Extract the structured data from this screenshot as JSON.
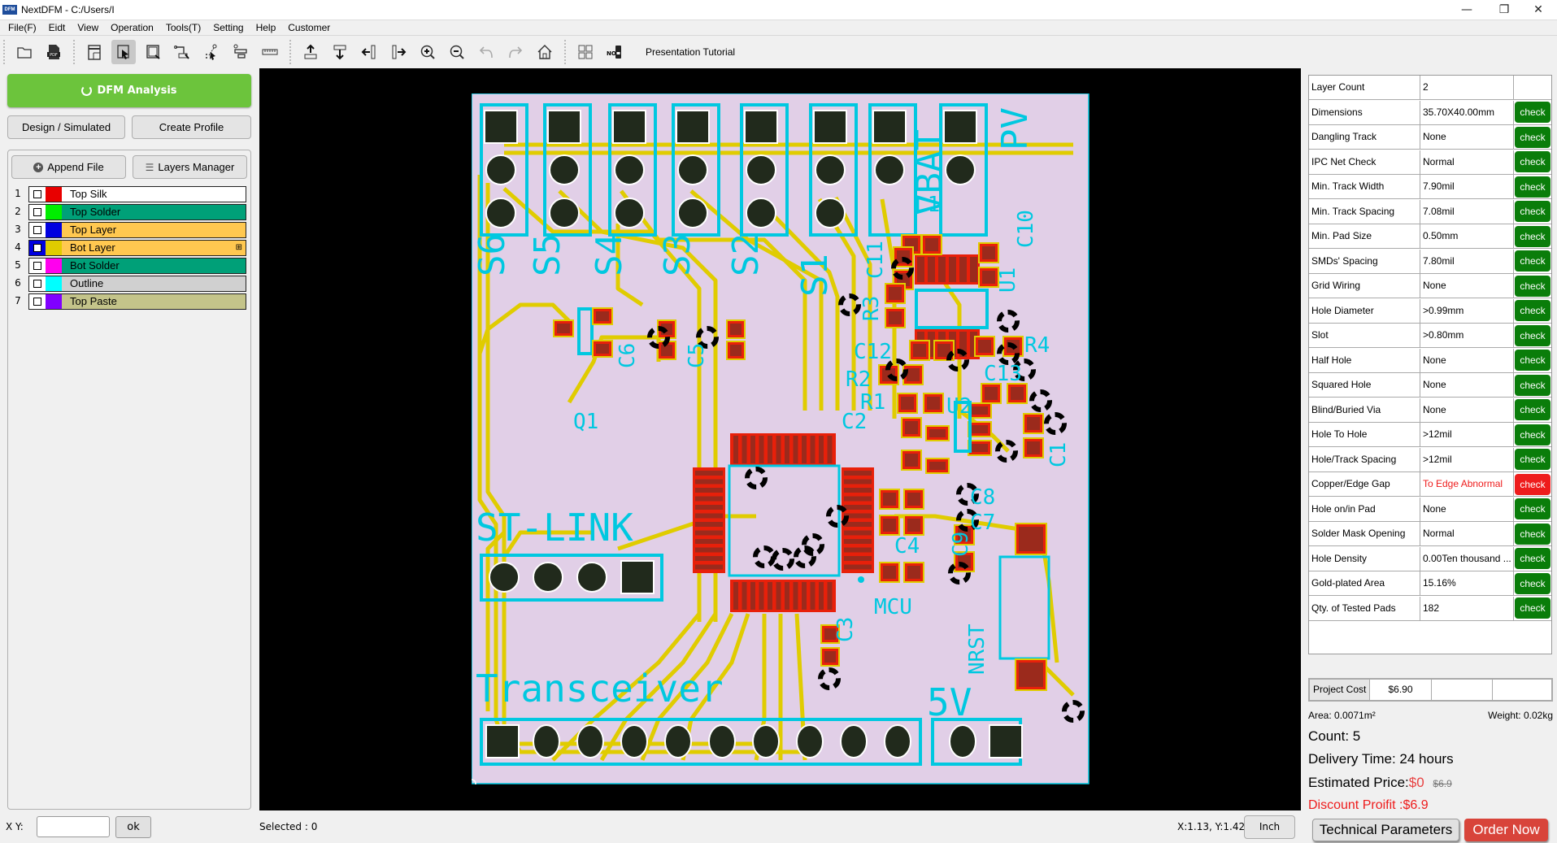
{
  "window": {
    "app_logo": "DFM",
    "title": "NextDFM - C:/Users/I",
    "controls": [
      "minimize",
      "restore",
      "close"
    ]
  },
  "menu": [
    "File(F)",
    "Eidt",
    "View",
    "Operation",
    "Tools(T)",
    "Setting",
    "Help",
    "Customer"
  ],
  "toolbar": {
    "groups": [
      [
        "open-folder-icon",
        "pdf-icon"
      ],
      [
        "single-view-icon",
        "select-icon",
        "window-select-icon",
        "move-select-icon",
        "node-select-icon",
        "align-icon",
        "ruler-icon"
      ],
      [
        "align-top-icon",
        "align-bottom-icon",
        "align-left-icon",
        "align-right-icon",
        "zoom-in-icon",
        "zoom-out-icon",
        "undo-icon",
        "redo-icon",
        "home-icon"
      ],
      [
        "panel-grid-icon",
        "number-icon"
      ]
    ],
    "active": "select-icon",
    "tutorial_label": "Presentation Tutorial"
  },
  "left_panel": {
    "dfm_button": "DFM Analysis",
    "design_button": "Design / Simulated",
    "create_profile_button": "Create Profile",
    "append_file_button": "Append File",
    "layers_manager_button": "Layers Manager",
    "layers": [
      {
        "num": "1",
        "name": "Top Silk",
        "swatch": "#e80000",
        "bg": "#ffffff",
        "checked": false
      },
      {
        "num": "2",
        "name": "Top Solder",
        "swatch": "#00ee00",
        "bg": "#00a078",
        "checked": false
      },
      {
        "num": "3",
        "name": "Top Layer",
        "swatch": "#0000e0",
        "bg": "#ffc850",
        "checked": false
      },
      {
        "num": "4",
        "name": "Bot Layer",
        "swatch": "#e0cc00",
        "bg": "#ffc850",
        "checked": true
      },
      {
        "num": "5",
        "name": "Bot Solder",
        "swatch": "#ff00ee",
        "bg": "#00a078",
        "checked": false
      },
      {
        "num": "6",
        "name": "Outline",
        "swatch": "#00ffff",
        "bg": "#d0d0d0",
        "checked": false
      },
      {
        "num": "7",
        "name": "Top Paste",
        "swatch": "#8000ff",
        "bg": "#c4c48a",
        "checked": false
      }
    ]
  },
  "pcb": {
    "board_labels": [
      "S6",
      "S5",
      "S4",
      "S3",
      "S2",
      "S1",
      "VBAT",
      "PV",
      "L1",
      "C10",
      "C11",
      "U1",
      "R3",
      "R4",
      "C12",
      "R2",
      "R1",
      "C13",
      "U2",
      "C1",
      "Q1",
      "C6",
      "C5",
      "C2",
      "C8",
      "C7",
      "C9",
      "C4",
      "MCU",
      "C3",
      "NRST",
      "ST-LINK",
      "Transceiver",
      "5V"
    ]
  },
  "right_panel": {
    "rows": [
      {
        "label": "Layer Count",
        "value": "2",
        "check": null
      },
      {
        "label": "Dimensions",
        "value": "35.70X40.00mm",
        "check": "ok"
      },
      {
        "label": "Dangling Track",
        "value": "None",
        "check": "ok"
      },
      {
        "label": "IPC Net Check",
        "value": "Normal",
        "check": "ok"
      },
      {
        "label": "Min. Track Width",
        "value": "7.90mil",
        "check": "ok"
      },
      {
        "label": "Min. Track Spacing",
        "value": "7.08mil",
        "check": "ok"
      },
      {
        "label": "Min. Pad Size",
        "value": "0.50mm",
        "check": "ok"
      },
      {
        "label": "SMDs' Spacing",
        "value": "7.80mil",
        "check": "ok"
      },
      {
        "label": "Grid Wiring",
        "value": "None",
        "check": "ok"
      },
      {
        "label": "Hole Diameter",
        "value": ">0.99mm",
        "check": "ok"
      },
      {
        "label": "Slot",
        "value": ">0.80mm",
        "check": "ok"
      },
      {
        "label": "Half Hole",
        "value": "None",
        "check": "ok"
      },
      {
        "label": "Squared Hole",
        "value": "None",
        "check": "ok"
      },
      {
        "label": "Blind/Buried Via",
        "value": "None",
        "check": "ok"
      },
      {
        "label": "Hole To Hole",
        "value": ">12mil",
        "check": "ok"
      },
      {
        "label": "Hole/Track Spacing",
        "value": ">12mil",
        "check": "ok"
      },
      {
        "label": "Copper/Edge Gap",
        "value": "To Edge Abnormal",
        "check": "bad"
      },
      {
        "label": "Hole on/in Pad",
        "value": "None",
        "check": "ok"
      },
      {
        "label": "Solder Mask Opening",
        "value": "Normal",
        "check": "ok"
      },
      {
        "label": "Hole Density",
        "value": "0.00Ten thousand ...",
        "check": "ok"
      },
      {
        "label": "Gold-plated Area",
        "value": "15.16%",
        "check": "ok"
      },
      {
        "label": "Qty. of Tested Pads",
        "value": "182",
        "check": "ok"
      }
    ],
    "check_label": "check",
    "colors": {
      "ok": "#0a7d0a",
      "bad": "#ee1c1c",
      "abnormal_text": "#ee1c1c"
    },
    "project_cost_label": "Project Cost",
    "project_cost_value": "$6.90",
    "area": "Area: 0.0071m²",
    "weight": "Weight: 0.02kg",
    "count": "Count: 5",
    "delivery": "Delivery Time: 24 hours",
    "estimated_label": "Estimated Price:",
    "estimated_price": "$0",
    "original_price": "$6.9",
    "discount": "Discount Proifit :$6.9",
    "tech_params_button": "Technical Parameters",
    "order_button": "Order Now"
  },
  "status": {
    "xy_label": "X Y:",
    "xy_value": "",
    "ok_button": "ok",
    "selected": "Selected : 0",
    "coords": "X:1.13, Y:1.42",
    "unit_button": "Inch"
  }
}
